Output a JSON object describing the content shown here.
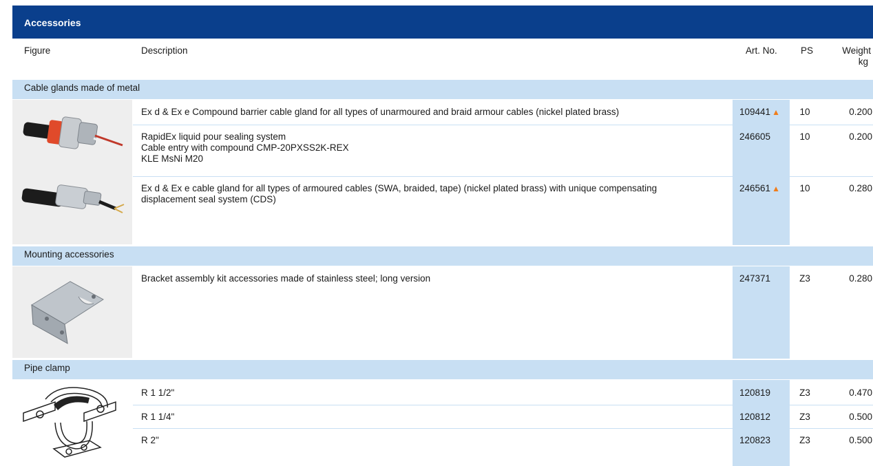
{
  "header": {
    "title": "Accessories"
  },
  "columns": {
    "figure": "Figure",
    "description": "Description",
    "art_no": "Art. No.",
    "ps": "PS",
    "weight": "Weight",
    "weight_unit": "kg"
  },
  "sections": [
    {
      "title": "Cable glands made of metal",
      "rows": [
        {
          "description": [
            "Ex d & Ex e Compound barrier cable gland for all types of unarmoured and braid armour cables (nickel plated brass)"
          ],
          "art_no": "109441",
          "flag": "▲",
          "ps": "10",
          "weight": "0.200"
        },
        {
          "description": [
            "RapidEx liquid pour sealing system",
            "Cable entry with compound CMP-20PXSS2K-REX",
            "KLE MsNi M20"
          ],
          "art_no": "246605",
          "flag": "",
          "ps": "10",
          "weight": "0.200"
        },
        {
          "description": [
            "Ex d & Ex e cable gland for all types of armoured cables (SWA, braided, tape) (nickel plated brass) with unique compensating",
            "displacement seal system (CDS)"
          ],
          "art_no": "246561",
          "flag": "▲",
          "ps": "10",
          "weight": "0.280"
        }
      ]
    },
    {
      "title": "Mounting accessories",
      "rows": [
        {
          "description": [
            "Bracket assembly kit accessories made of stainless steel; long version"
          ],
          "art_no": "247371",
          "flag": "",
          "ps": "Z3",
          "weight": "0.280"
        }
      ]
    },
    {
      "title": "Pipe clamp",
      "rows": [
        {
          "description": [
            "R 1 1/2\""
          ],
          "art_no": "120819",
          "flag": "",
          "ps": "Z3",
          "weight": "0.470"
        },
        {
          "description": [
            "R 1 1/4\""
          ],
          "art_no": "120812",
          "flag": "",
          "ps": "Z3",
          "weight": "0.500"
        },
        {
          "description": [
            "R 2\""
          ],
          "art_no": "120823",
          "flag": "",
          "ps": "Z3",
          "weight": "0.500"
        }
      ]
    }
  ],
  "colors": {
    "header_bg": "#0a3f8c",
    "section_bg": "#c8dff3",
    "flag": "#f07d1a"
  },
  "icons": [
    "cable-gland-red-image",
    "cable-gland-armoured-image",
    "bracket-image",
    "pipe-clamp-image"
  ]
}
